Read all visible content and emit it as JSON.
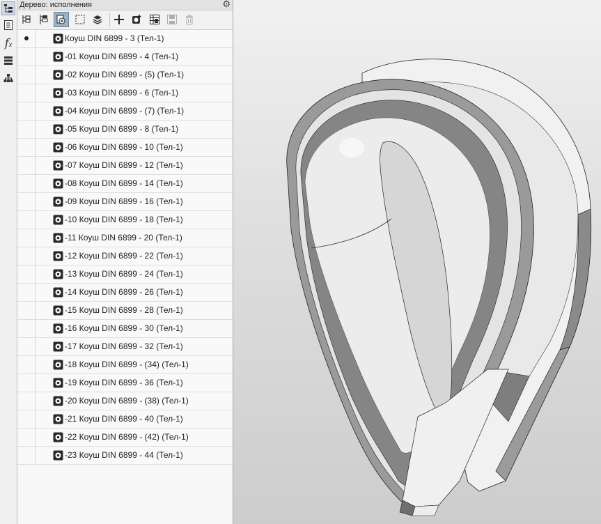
{
  "panel": {
    "title": "Дерево: исполнения"
  },
  "toolbar": {
    "buttons": [
      {
        "name": "tree-structure-icon"
      },
      {
        "name": "tree-branch-icon"
      },
      {
        "name": "variant-properties-icon",
        "pressed": true
      },
      {
        "name": "select-frame-icon"
      },
      {
        "name": "layers-icon"
      },
      {
        "name": "add-icon"
      },
      {
        "name": "create-variant-icon"
      },
      {
        "name": "table-edit-icon"
      },
      {
        "name": "save-icon",
        "disabled": true
      },
      {
        "name": "delete-icon",
        "disabled": true
      }
    ]
  },
  "sidebar": {
    "icons": [
      "tree-icon",
      "properties-icon",
      "variables-fx-icon",
      "layers-list-icon",
      "hierarchy-icon"
    ],
    "fx_label": "f"
  },
  "tree": {
    "items": [
      {
        "label": "Коуш DIN 6899 - 3 (Тел-1)",
        "current": true
      },
      {
        "label": "-01 Коуш DIN 6899 - 4 (Тел-1)"
      },
      {
        "label": "-02 Коуш DIN 6899 - (5) (Тел-1)"
      },
      {
        "label": "-03 Коуш DIN 6899 - 6 (Тел-1)"
      },
      {
        "label": "-04 Коуш DIN 6899 - (7) (Тел-1)"
      },
      {
        "label": "-05 Коуш DIN 6899 - 8 (Тел-1)"
      },
      {
        "label": "-06 Коуш DIN 6899 - 10 (Тел-1)"
      },
      {
        "label": "-07 Коуш DIN 6899 - 12 (Тел-1)"
      },
      {
        "label": "-08 Коуш DIN 6899 - 14 (Тел-1)"
      },
      {
        "label": "-09 Коуш DIN 6899 - 16 (Тел-1)"
      },
      {
        "label": "-10 Коуш DIN 6899 - 18 (Тел-1)"
      },
      {
        "label": "-11 Коуш DIN 6899 - 20 (Тел-1)"
      },
      {
        "label": "-12 Коуш DIN 6899 - 22 (Тел-1)"
      },
      {
        "label": "-13 Коуш DIN 6899 - 24 (Тел-1)"
      },
      {
        "label": "-14 Коуш DIN 6899 - 26 (Тел-1)"
      },
      {
        "label": "-15 Коуш DIN 6899 - 28 (Тел-1)"
      },
      {
        "label": "-16 Коуш DIN 6899 - 30 (Тел-1)"
      },
      {
        "label": "-17 Коуш DIN 6899 - 32 (Тел-1)"
      },
      {
        "label": "-18 Коуш DIN 6899 - (34) (Тел-1)"
      },
      {
        "label": "-19 Коуш DIN 6899 - 36 (Тел-1)"
      },
      {
        "label": "-20 Коуш DIN 6899 - (38) (Тел-1)"
      },
      {
        "label": "-21 Коуш DIN 6899 - 40 (Тел-1)"
      },
      {
        "label": "-22 Коуш DIN 6899 - (42) (Тел-1)"
      },
      {
        "label": "-23 Коуш DIN 6899 - 44 (Тел-1)"
      }
    ]
  },
  "colors": {
    "selected_button": "#9db0c4",
    "panel_bg": "#f7f7f7",
    "model_face": "#e6e6e6",
    "model_side": "#8d8d8d"
  }
}
